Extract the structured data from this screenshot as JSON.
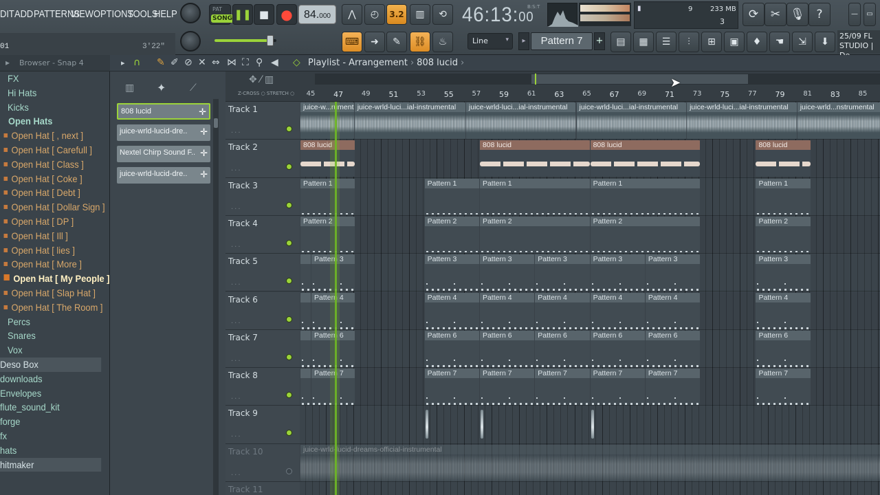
{
  "menu": {
    "items": [
      "DIT",
      "ADD",
      "PATTERNS",
      "VIEW",
      "OPTIONS",
      "TOOLS",
      "HELP"
    ]
  },
  "hint_bar": {
    "left": "01",
    "right": "3'22\""
  },
  "transport": {
    "pat_label": "PAT",
    "song_label": "SONG",
    "tempo_main": "84.",
    "tempo_frac": "000",
    "time_main": "46:13:",
    "time_frac": "00",
    "time_unit": "B:S:T",
    "blend_label": "3.2"
  },
  "monitor": {
    "polyphony": "9",
    "memory": "233 MB",
    "cpu_count": "3"
  },
  "toolbar2": {
    "snap": "Line",
    "pattern": "Pattern 7"
  },
  "news": {
    "line1": "25/09  FL",
    "line2": "STUDIO | De"
  },
  "browser": {
    "title": "Browser - Snap 4",
    "items": [
      {
        "label": "FX",
        "type": "folder"
      },
      {
        "label": "Hi Hats",
        "type": "folder"
      },
      {
        "label": "Kicks",
        "type": "folder"
      },
      {
        "label": "Open Hats",
        "type": "open"
      },
      {
        "label": "Open Hat [ , next ]",
        "type": "sub"
      },
      {
        "label": "Open Hat [ Carefull ]",
        "type": "sub"
      },
      {
        "label": "Open Hat [ Class ]",
        "type": "sub"
      },
      {
        "label": "Open Hat [ Coke ]",
        "type": "sub"
      },
      {
        "label": "Open Hat [ Debt ]",
        "type": "sub"
      },
      {
        "label": "Open Hat [ Dollar Sign ]",
        "type": "sub"
      },
      {
        "label": "Open Hat [ DP ]",
        "type": "sub"
      },
      {
        "label": "Open Hat [ Ill ]",
        "type": "sub"
      },
      {
        "label": "Open Hat [ lies ]",
        "type": "sub"
      },
      {
        "label": "Open Hat [ More ]",
        "type": "sub"
      },
      {
        "label": "Open Hat [ My People ]",
        "type": "hl"
      },
      {
        "label": "Open Hat [ Slap Hat ]",
        "type": "sub"
      },
      {
        "label": "Open Hat [ The Room ]",
        "type": "sub"
      },
      {
        "label": "Percs",
        "type": "folder"
      },
      {
        "label": "Snares",
        "type": "folder"
      },
      {
        "label": "Vox",
        "type": "folder"
      },
      {
        "label": "Deso Box",
        "type": "bar"
      },
      {
        "label": "downloads",
        "type": "folder"
      },
      {
        "label": "Envelopes",
        "type": "folder"
      },
      {
        "label": "flute_sound_kit",
        "type": "folder"
      },
      {
        "label": "forge",
        "type": "folder"
      },
      {
        "label": "fx",
        "type": "folder"
      },
      {
        "label": "hats",
        "type": "folder"
      },
      {
        "label": "hitmaker",
        "type": "bar"
      }
    ]
  },
  "playlist": {
    "title": "Playlist - Arrangement",
    "breadcrumb": "808 lucid",
    "picker": [
      "808 lucid",
      "juice-wrld-lucid-dre..",
      "Nextel Chirp Sound  F..",
      "juice-wrld-lucid-dre.."
    ],
    "ruler": [
      "45",
      "47",
      "49",
      "51",
      "53",
      "55",
      "57",
      "59",
      "61",
      "63",
      "65",
      "67",
      "69",
      "71",
      "73",
      "75",
      "77",
      "79",
      "81",
      "83",
      "85"
    ],
    "zcross": "Z-CROSS",
    "stretch": "STRETCH",
    "tracks": [
      {
        "name": "Track 1",
        "dim": false
      },
      {
        "name": "Track 2",
        "dim": false
      },
      {
        "name": "Track 3",
        "dim": false
      },
      {
        "name": "Track 4",
        "dim": false
      },
      {
        "name": "Track 5",
        "dim": false
      },
      {
        "name": "Track 6",
        "dim": false
      },
      {
        "name": "Track 7",
        "dim": false
      },
      {
        "name": "Track 8",
        "dim": false
      },
      {
        "name": "Track 9",
        "dim": false
      },
      {
        "name": "Track 10",
        "dim": true
      },
      {
        "name": "Track 11",
        "dim": true
      }
    ],
    "clips": [
      {
        "track": 0,
        "type": "audio",
        "start": 0,
        "end": 1.96,
        "label": "juice-w...rumental"
      },
      {
        "track": 0,
        "type": "audio",
        "start": 1.96,
        "end": 6.0,
        "label": "juice-wrld-luci...ial-instrumental"
      },
      {
        "track": 0,
        "type": "audio",
        "start": 6.0,
        "end": 10.0,
        "label": "juice-wrld-luci...ial-instrumental"
      },
      {
        "track": 0,
        "type": "audio",
        "start": 10.0,
        "end": 14.0,
        "label": "juice-wrld-luci...ial-instrumental"
      },
      {
        "track": 0,
        "type": "audio",
        "start": 14.0,
        "end": 18.0,
        "label": "juice-wrld-luci...ial-instrumental"
      },
      {
        "track": 0,
        "type": "audio",
        "start": 18.0,
        "end": 21.2,
        "label": "juice-wrld...nstrumental"
      },
      {
        "track": 1,
        "type": "lucid",
        "start": 0,
        "end": 2.0,
        "label": "808 lucid"
      },
      {
        "track": 1,
        "type": "lucid",
        "start": 6.5,
        "end": 10.5,
        "label": "808 lucid"
      },
      {
        "track": 1,
        "type": "lucid",
        "start": 10.5,
        "end": 14.5,
        "label": "808 lucid"
      },
      {
        "track": 1,
        "type": "lucid",
        "start": 16.5,
        "end": 18.5,
        "label": "808 lucid"
      },
      {
        "track": 2,
        "type": "pat",
        "start": 0,
        "end": 2.0,
        "label": "Pattern 1"
      },
      {
        "track": 2,
        "type": "pat",
        "start": 4.5,
        "end": 6.5,
        "label": "Pattern 1"
      },
      {
        "track": 2,
        "type": "pat",
        "start": 6.5,
        "end": 10.5,
        "label": "Pattern 1"
      },
      {
        "track": 2,
        "type": "pat",
        "start": 10.5,
        "end": 14.5,
        "label": "Pattern 1"
      },
      {
        "track": 2,
        "type": "pat",
        "start": 16.5,
        "end": 18.5,
        "label": "Pattern 1"
      },
      {
        "track": 3,
        "type": "pat",
        "start": 0,
        "end": 2.0,
        "label": "Pattern 2"
      },
      {
        "track": 3,
        "type": "pat",
        "start": 4.5,
        "end": 6.5,
        "label": "Pattern 2"
      },
      {
        "track": 3,
        "type": "pat",
        "start": 6.5,
        "end": 10.5,
        "label": "Pattern 2"
      },
      {
        "track": 3,
        "type": "pat",
        "start": 10.5,
        "end": 14.5,
        "label": "Pattern 2"
      },
      {
        "track": 3,
        "type": "pat",
        "start": 16.5,
        "end": 18.5,
        "label": "Pattern 2"
      },
      {
        "track": 4,
        "type": "pat",
        "start": 0,
        "end": 0.4,
        "label": ""
      },
      {
        "track": 4,
        "type": "pat",
        "start": 0.4,
        "end": 2.0,
        "label": "Pattern 3"
      },
      {
        "track": 4,
        "type": "pat",
        "start": 4.5,
        "end": 6.5,
        "label": "Pattern 3"
      },
      {
        "track": 4,
        "type": "pat",
        "start": 6.5,
        "end": 8.5,
        "label": "Pattern 3"
      },
      {
        "track": 4,
        "type": "pat",
        "start": 8.5,
        "end": 10.5,
        "label": "Pattern 3"
      },
      {
        "track": 4,
        "type": "pat",
        "start": 10.5,
        "end": 12.5,
        "label": "Pattern 3"
      },
      {
        "track": 4,
        "type": "pat",
        "start": 12.5,
        "end": 14.5,
        "label": "Pattern 3"
      },
      {
        "track": 4,
        "type": "pat",
        "start": 16.5,
        "end": 18.5,
        "label": "Pattern 3"
      },
      {
        "track": 5,
        "type": "pat",
        "start": 0,
        "end": 0.4,
        "label": ""
      },
      {
        "track": 5,
        "type": "pat",
        "start": 0.4,
        "end": 2.0,
        "label": "Pattern 4"
      },
      {
        "track": 5,
        "type": "pat",
        "start": 4.5,
        "end": 6.5,
        "label": "Pattern 4"
      },
      {
        "track": 5,
        "type": "pat",
        "start": 6.5,
        "end": 8.5,
        "label": "Pattern 4"
      },
      {
        "track": 5,
        "type": "pat",
        "start": 8.5,
        "end": 10.5,
        "label": "Pattern 4"
      },
      {
        "track": 5,
        "type": "pat",
        "start": 10.5,
        "end": 12.5,
        "label": "Pattern 4"
      },
      {
        "track": 5,
        "type": "pat",
        "start": 12.5,
        "end": 14.5,
        "label": "Pattern 4"
      },
      {
        "track": 5,
        "type": "pat",
        "start": 16.5,
        "end": 18.5,
        "label": "Pattern 4"
      },
      {
        "track": 6,
        "type": "pat",
        "start": 0,
        "end": 0.4,
        "label": ""
      },
      {
        "track": 6,
        "type": "pat",
        "start": 0.4,
        "end": 2.0,
        "label": "Pattern 6"
      },
      {
        "track": 6,
        "type": "pat",
        "start": 4.5,
        "end": 6.5,
        "label": "Pattern 6"
      },
      {
        "track": 6,
        "type": "pat",
        "start": 6.5,
        "end": 8.5,
        "label": "Pattern 6"
      },
      {
        "track": 6,
        "type": "pat",
        "start": 8.5,
        "end": 10.5,
        "label": "Pattern 6"
      },
      {
        "track": 6,
        "type": "pat",
        "start": 10.5,
        "end": 12.5,
        "label": "Pattern 6"
      },
      {
        "track": 6,
        "type": "pat",
        "start": 12.5,
        "end": 14.5,
        "label": "Pattern 6"
      },
      {
        "track": 6,
        "type": "pat",
        "start": 16.5,
        "end": 18.5,
        "label": "Pattern 6"
      },
      {
        "track": 7,
        "type": "pat",
        "start": 0,
        "end": 0.4,
        "label": ""
      },
      {
        "track": 7,
        "type": "pat",
        "start": 0.4,
        "end": 2.0,
        "label": "Pattern 7"
      },
      {
        "track": 7,
        "type": "pat",
        "start": 4.5,
        "end": 6.5,
        "label": "Pattern 7"
      },
      {
        "track": 7,
        "type": "pat",
        "start": 6.5,
        "end": 8.5,
        "label": "Pattern 7"
      },
      {
        "track": 7,
        "type": "pat",
        "start": 8.5,
        "end": 10.5,
        "label": "Pattern 7"
      },
      {
        "track": 7,
        "type": "pat",
        "start": 10.5,
        "end": 12.5,
        "label": "Pattern 7"
      },
      {
        "track": 7,
        "type": "pat",
        "start": 12.5,
        "end": 14.5,
        "label": "Pattern 7"
      },
      {
        "track": 7,
        "type": "pat",
        "start": 16.5,
        "end": 18.5,
        "label": "Pattern 7"
      },
      {
        "track": 9,
        "type": "audio-big",
        "start": 0,
        "end": 21.2,
        "label": "juice-wrld-lucid-dreams-official-instrumental"
      }
    ],
    "track9_marks": [
      4.5,
      6.5,
      10.5
    ]
  }
}
